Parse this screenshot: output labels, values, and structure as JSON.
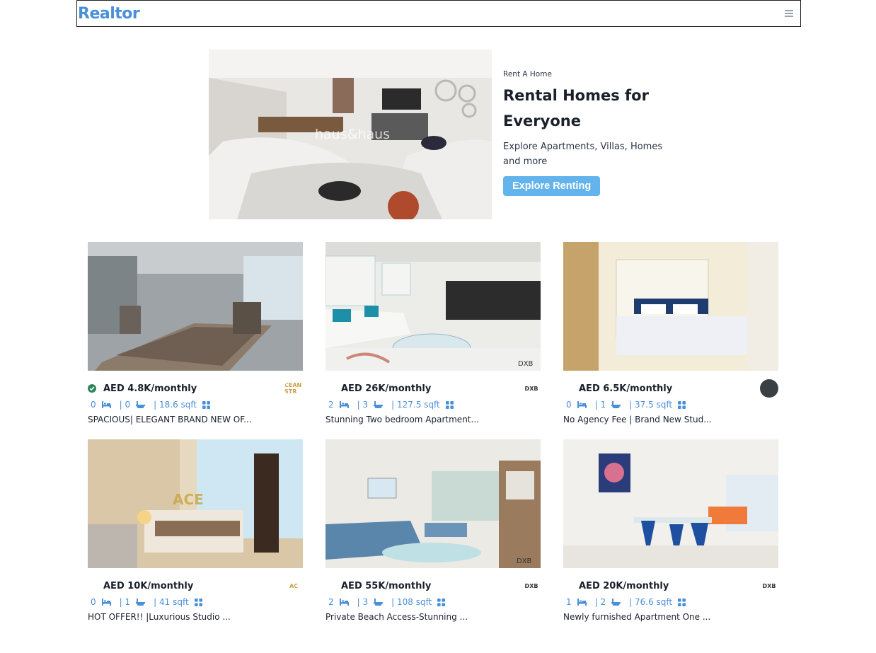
{
  "header": {
    "logo": "Realtor"
  },
  "hero": {
    "purpose": "Rent A Home",
    "title_line1": "Rental Homes for",
    "title_line2": "Everyone",
    "desc_line1": "Explore Apartments, Villas, Homes",
    "desc_line2": "and more",
    "button_label": "Explore Renting",
    "image_watermark": "haus&haus"
  },
  "colors": {
    "accent": "#4a90d9",
    "button": "#63b3ed",
    "verified": "#2f855a"
  },
  "listings": [
    {
      "price": "AED 4.8K/monthly",
      "verified": true,
      "rooms": "0",
      "baths": "| 0",
      "area": "| 18.6 sqft",
      "title": "SPACIOUS| ELEGANT BRAND NEW OF...",
      "agency_logo": "CEAN STR",
      "scene": "office"
    },
    {
      "price": "AED 26K/monthly",
      "verified": false,
      "rooms": "2",
      "baths": "| 3",
      "area": "| 127.5 sqft",
      "title": "Stunning Two bedroom Apartment...",
      "agency_logo": "DXB",
      "scene": "living"
    },
    {
      "price": "AED 6.5K/monthly",
      "verified": false,
      "rooms": "0",
      "baths": "| 1",
      "area": "| 37.5 sqft",
      "title": "No Agency Fee | Brand New Stud...",
      "agency_logo": "",
      "scene": "bedroom"
    },
    {
      "price": "AED 10K/monthly",
      "verified": false,
      "rooms": "0",
      "baths": "| 1",
      "area": "| 41 sqft",
      "title": "HOT OFFER!! |Luxurious Studio ...",
      "agency_logo": "AC",
      "scene": "hotel"
    },
    {
      "price": "AED 55K/monthly",
      "verified": false,
      "rooms": "2",
      "baths": "| 3",
      "area": "| 108 sqft",
      "title": "Private Beach Access-Stunning ...",
      "agency_logo": "DXB",
      "scene": "lounge"
    },
    {
      "price": "AED 20K/monthly",
      "verified": false,
      "rooms": "1",
      "baths": "| 2",
      "area": "| 76.6 sqft",
      "title": "Newly furnished Apartment One ...",
      "agency_logo": "DXB",
      "scene": "dining"
    }
  ]
}
